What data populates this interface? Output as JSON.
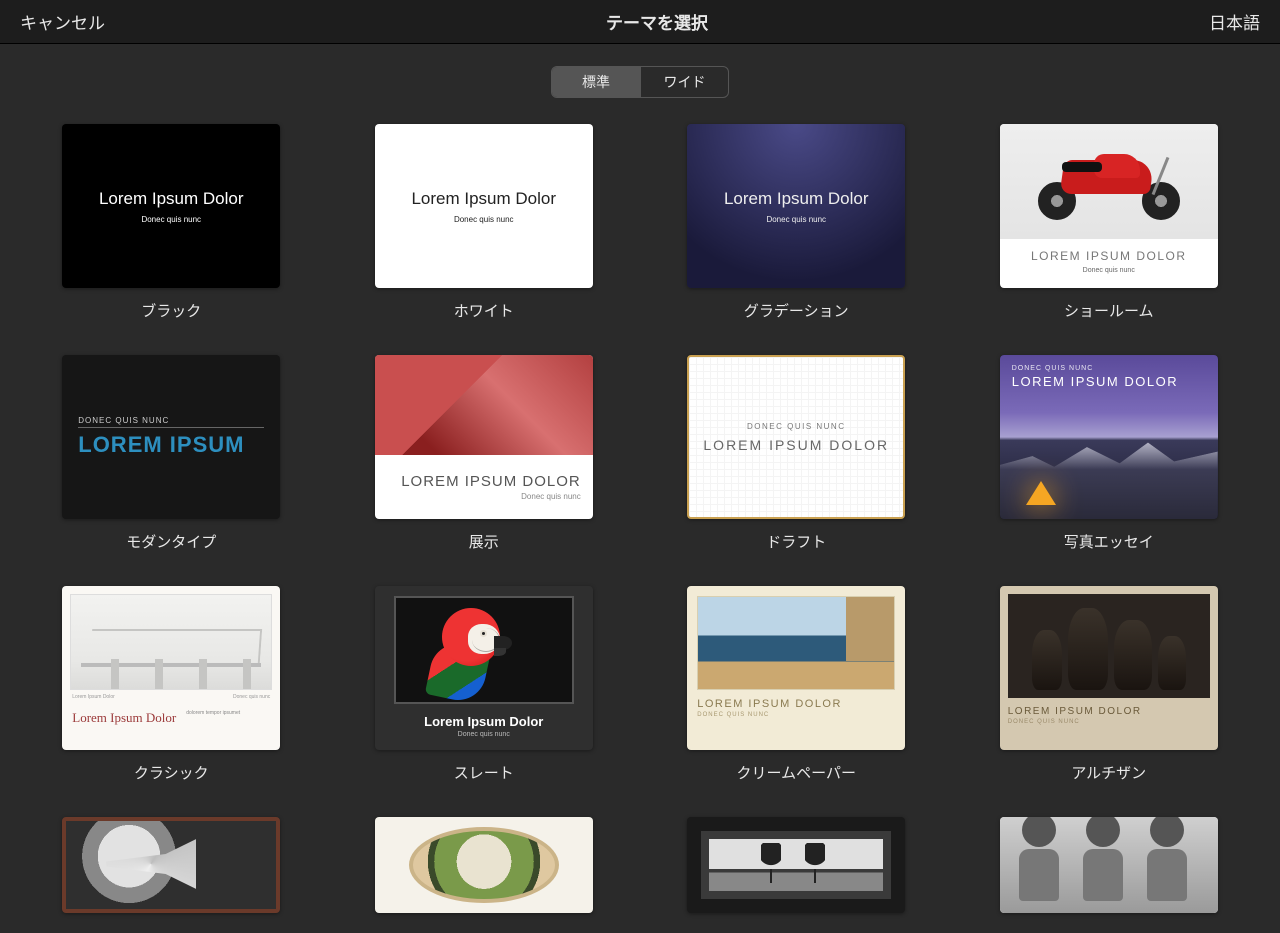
{
  "header": {
    "cancel": "キャンセル",
    "title": "テーマを選択",
    "language": "日本語"
  },
  "segmented": {
    "standard": "標準",
    "wide": "ワイド",
    "active": "standard"
  },
  "placeholder": {
    "title": "Lorem Ipsum Dolor",
    "subtitle": "Donec quis nunc",
    "title_upper": "LOREM IPSUM DOLOR",
    "short_upper": "LOREM IPSUM",
    "sub_upper": "DONEC QUIS NUNC",
    "lorem_long": "dolorem tempor ipsumet"
  },
  "themes": [
    {
      "id": "black",
      "label": "ブラック"
    },
    {
      "id": "white",
      "label": "ホワイト"
    },
    {
      "id": "gradient",
      "label": "グラデーション"
    },
    {
      "id": "showroom",
      "label": "ショールーム"
    },
    {
      "id": "modern",
      "label": "モダンタイプ"
    },
    {
      "id": "exhibit",
      "label": "展示"
    },
    {
      "id": "draft",
      "label": "ドラフト"
    },
    {
      "id": "photo",
      "label": "写真エッセイ"
    },
    {
      "id": "classic",
      "label": "クラシック"
    },
    {
      "id": "slate",
      "label": "スレート"
    },
    {
      "id": "cream",
      "label": "クリームペーパー"
    },
    {
      "id": "artisan",
      "label": "アルチザン"
    }
  ]
}
